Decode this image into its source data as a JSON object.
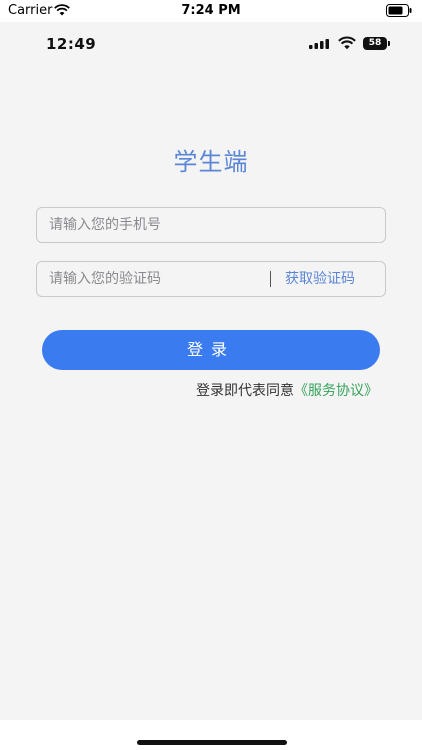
{
  "ios_status": {
    "carrier": "Carrier",
    "time": "7:24 PM"
  },
  "inner_status": {
    "time": "12:49",
    "battery": "58"
  },
  "title": "学生端",
  "phone_field": {
    "placeholder": "请输入您的手机号",
    "value": ""
  },
  "code_field": {
    "placeholder": "请输入您的验证码",
    "value": "",
    "get_code_label": "获取验证码"
  },
  "login_button": "登录",
  "agreement": {
    "text": "登录即代表同意",
    "link": "《服务协议》"
  },
  "colors": {
    "accent": "#3b7bf0",
    "title": "#5b86d6",
    "link": "#36a35a",
    "background": "#f4f4f5"
  }
}
